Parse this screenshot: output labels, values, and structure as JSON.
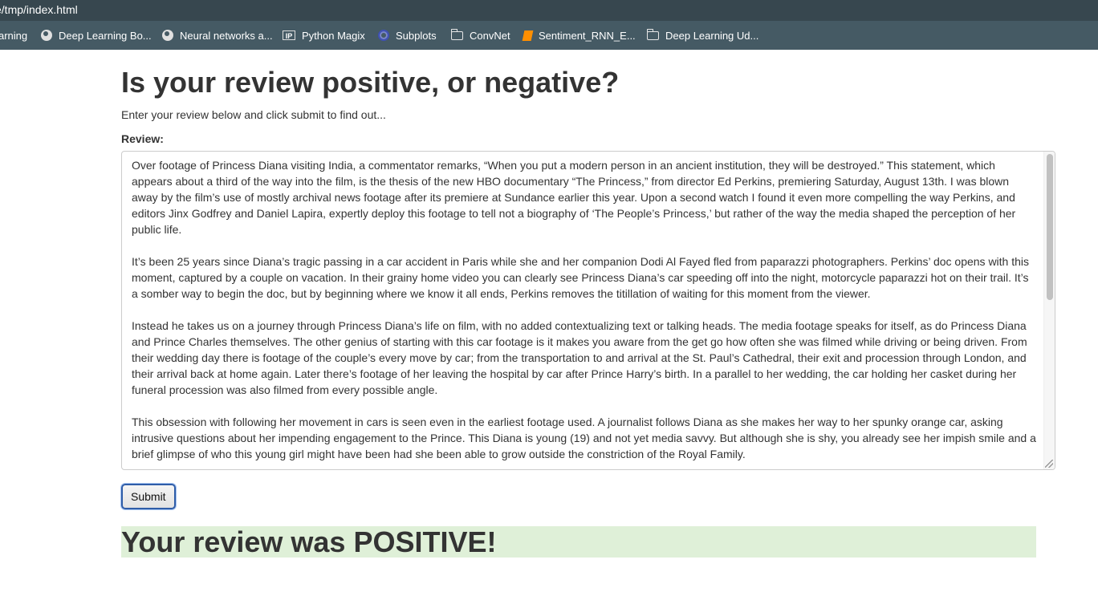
{
  "browser": {
    "url": "e/tmp/index.html",
    "bookmarks": [
      {
        "label": "arning",
        "icon": "none"
      },
      {
        "label": "Deep Learning Bo...",
        "icon": "globe-icon"
      },
      {
        "label": "Neural networks a...",
        "icon": "globe-icon"
      },
      {
        "label": "Python Magix",
        "icon": "ipython-icon"
      },
      {
        "label": "Subplots",
        "icon": "ring-icon"
      },
      {
        "label": "ConvNet",
        "icon": "folder-icon"
      },
      {
        "label": "Sentiment_RNN_E...",
        "icon": "book-icon"
      },
      {
        "label": "Deep Learning Ud...",
        "icon": "folder-icon"
      }
    ]
  },
  "page": {
    "title": "Is your review positive, or negative?",
    "lead": "Enter your review below and click submit to find out...",
    "review_label": "Review:",
    "review_paragraphs": [
      "Over footage of Princess Diana visiting India, a commentator remarks, “When you put a modern person in an ancient institution, they will be destroyed.” This statement, which appears about a third of the way into the film, is the thesis of the new HBO documentary “The Princess,” from director Ed Perkins, premiering Saturday, August 13th. I was blown away by the film’s use of mostly archival news footage after its premiere at Sundance earlier this year. Upon a second watch I found it even more compelling the way Perkins, and editors Jinx Godfrey and Daniel Lapira, expertly deploy this footage to tell not a biography of ‘The People’s Princess,’ but rather of the way the media shaped the perception of her public life.",
      "It’s been 25 years since Diana’s tragic passing in a car accident in Paris while she and her companion Dodi Al Fayed fled from paparazzi photographers. Perkins’ doc opens with this moment, captured by a couple on vacation. In their grainy home video you can clearly see Princess Diana’s car speeding off into the night, motorcycle paparazzi hot on their trail. It’s a somber way to begin the doc, but by beginning where we know it all ends, Perkins removes the titillation of waiting for this moment from the viewer.",
      "Instead he takes us on a journey through Princess Diana’s life on film, with no added contextualizing text or talking heads. The media footage speaks for itself, as do Princess Diana and Prince Charles themselves. The other genius of starting with this car footage is it makes you aware from the get go how often she was filmed while driving or being driven. From their wedding day there is footage of the couple’s every move by car; from the transportation to and arrival at the St. Paul’s Cathedral, their exit and procession through London, and their arrival back at home again. Later there’s footage of her leaving the hospital by car after Prince Harry’s birth. In a parallel to her wedding, the car holding her casket during her funeral procession was also filmed from every possible angle.",
      "This obsession with following her movement in cars is seen even in the earliest footage used. A journalist follows Diana as she makes her way to her spunky orange car, asking intrusive questions about her impending engagement to the Prince. This Diana is young (19) and not yet media savvy. But although she is shy, you already see her impish smile and a brief glimpse of who this young girl might have been had she been able to grow outside the constriction of the Royal Family."
    ],
    "submit_label": "Submit",
    "result_text": "Your review was POSITIVE!",
    "result_color": "#dff0d8"
  }
}
